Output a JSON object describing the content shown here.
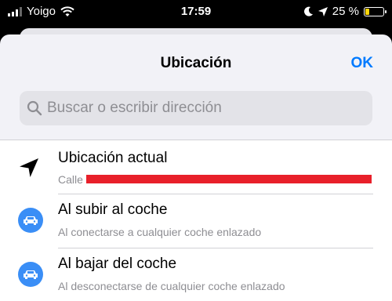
{
  "status_bar": {
    "carrier": "Yoigo",
    "time": "17:59",
    "battery_percent": "25 %",
    "battery_level": 0.25,
    "icons": [
      "signal-icon",
      "wifi-icon",
      "moon-icon",
      "location-arrow-icon",
      "battery-icon"
    ]
  },
  "header": {
    "title": "Ubicación",
    "ok_label": "OK"
  },
  "search": {
    "placeholder": "Buscar o escribir dirección",
    "icon": "search-icon"
  },
  "rows": [
    {
      "title": "Ubicación actual",
      "subtitle": "Calle",
      "icon": "location-arrow-icon",
      "subtitle_redacted": true
    },
    {
      "title": "Al subir al coche",
      "subtitle": "Al conectarse a cualquier coche enlazado",
      "icon": "car-icon"
    },
    {
      "title": "Al bajar del coche",
      "subtitle": "Al desconectarse de cualquier coche enlazado",
      "icon": "car-icon"
    }
  ],
  "colors": {
    "accent": "#007aff",
    "car_badge": "#3a8ef6",
    "redaction": "#e8202a",
    "battery": "#ffd60a"
  }
}
